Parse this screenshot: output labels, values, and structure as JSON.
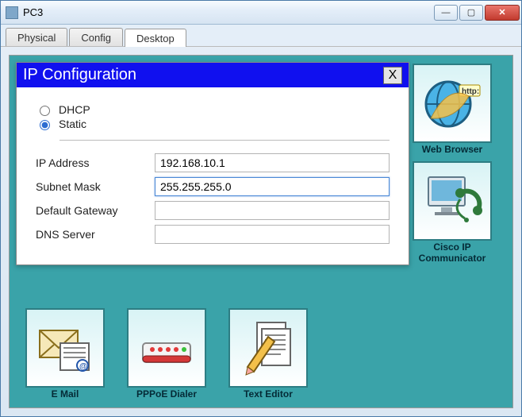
{
  "window": {
    "title": "PC3",
    "buttons": {
      "min": "—",
      "max": "▢",
      "close": "✕"
    }
  },
  "tabs": [
    {
      "label": "Physical",
      "active": false
    },
    {
      "label": "Config",
      "active": false
    },
    {
      "label": "Desktop",
      "active": true
    }
  ],
  "ipcfg": {
    "title": "IP Configuration",
    "close_label": "X",
    "mode": {
      "dhcp": {
        "label": "DHCP",
        "selected": false
      },
      "static": {
        "label": "Static",
        "selected": true
      }
    },
    "fields": {
      "ip": {
        "label": "IP Address",
        "value": "192.168.10.1"
      },
      "mask": {
        "label": "Subnet Mask",
        "value": "255.255.255.0"
      },
      "gateway": {
        "label": "Default Gateway",
        "value": ""
      },
      "dns": {
        "label": "DNS Server",
        "value": ""
      }
    }
  },
  "desktop_icons": {
    "right": [
      {
        "id": "web-browser",
        "label": "Web Browser",
        "icon": "globe-icon"
      },
      {
        "id": "ip-communicator",
        "label": "Cisco IP Communicator",
        "icon": "headset-monitor-icon"
      }
    ],
    "bottom": [
      {
        "id": "email",
        "label": "E Mail",
        "icon": "envelope-icon"
      },
      {
        "id": "pppoe",
        "label": "PPPoE Dialer",
        "icon": "modem-icon"
      },
      {
        "id": "text",
        "label": "Text Editor",
        "icon": "text-editor-icon"
      }
    ]
  }
}
